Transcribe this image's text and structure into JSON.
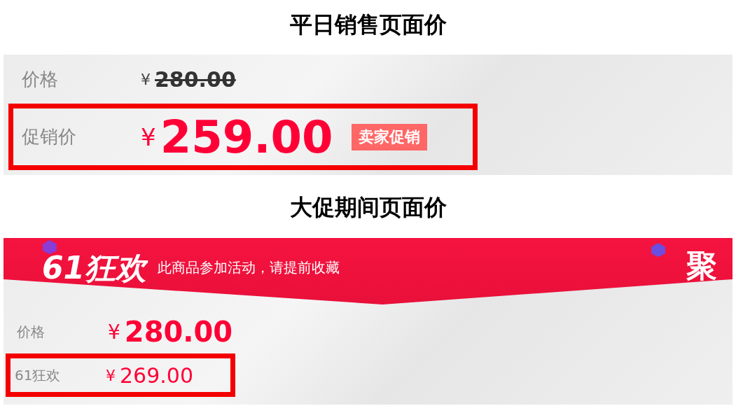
{
  "sections": [
    {
      "title": "平日销售页面价",
      "kind": "regular",
      "rows": [
        {
          "label": "价格",
          "currency": "¥",
          "amount": "280.00",
          "kind": "original",
          "highlighted": false
        },
        {
          "label": "促销价",
          "currency": "¥",
          "amount": "259.00",
          "kind": "promo",
          "highlighted": true,
          "tag": "卖家促销"
        }
      ]
    },
    {
      "title": "大促期间页面价",
      "kind": "event",
      "banner": {
        "logo": "61狂欢",
        "slogan": "此商品参加活动，请提前收藏",
        "badge": "聚"
      },
      "rows": [
        {
          "label": "价格",
          "currency": "¥",
          "amount": "280.00",
          "kind": "large",
          "highlighted": false
        },
        {
          "label": "61狂欢",
          "currency": "¥",
          "amount": "269.00",
          "kind": "event",
          "highlighted": true
        }
      ]
    }
  ]
}
